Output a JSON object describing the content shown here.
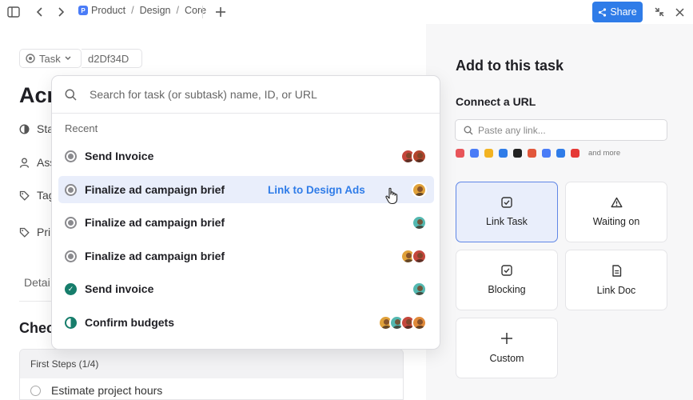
{
  "topbar": {
    "breadcrumb": [
      "Product",
      "Design",
      "Core"
    ],
    "project_badge": "P",
    "share_label": "Share"
  },
  "task": {
    "type_label": "Task",
    "id": "d2Df34D",
    "title_visible": "Acn",
    "fields": [
      {
        "label": "Sta",
        "icon": "status-icon"
      },
      {
        "label": "Ass",
        "icon": "user-icon"
      },
      {
        "label": "Tag",
        "icon": "tag-icon"
      },
      {
        "label": "Pri",
        "icon": "tag-icon"
      }
    ],
    "tabs_visible": "Detai",
    "checklists_visible": "Chec",
    "checklist": {
      "header": "First Steps (1/4)",
      "items": [
        "Estimate project hours"
      ]
    }
  },
  "dropdown": {
    "search_placeholder": "Search for task (or subtask) name, ID, or URL",
    "section_label": "Recent",
    "rows": [
      {
        "label": "Send Invoice",
        "status": "todo",
        "avatars": [
          "#c5463b",
          "#b3452d"
        ],
        "highlighted": false,
        "link_label": ""
      },
      {
        "label": "Finalize ad campaign brief",
        "status": "todo",
        "avatars": [
          "#e0a13a"
        ],
        "highlighted": true,
        "link_label": "Link to Design Ads"
      },
      {
        "label": "Finalize ad campaign brief",
        "status": "todo",
        "avatars": [
          "#53b8b0"
        ],
        "highlighted": false,
        "link_label": ""
      },
      {
        "label": "Finalize ad campaign brief",
        "status": "todo",
        "avatars": [
          "#e0a13a",
          "#c4473c"
        ],
        "highlighted": false,
        "link_label": ""
      },
      {
        "label": "Send invoice",
        "status": "done",
        "avatars": [
          "#53b8b0"
        ],
        "highlighted": false,
        "link_label": ""
      },
      {
        "label": "Confirm budgets",
        "status": "in-progress",
        "avatars": [
          "#e0a13a",
          "#53b8b0",
          "#c4473c",
          "#e08a3a"
        ],
        "highlighted": false,
        "link_label": ""
      }
    ]
  },
  "panel": {
    "title": "Add to this task",
    "connect_label": "Connect a URL",
    "url_placeholder": "Paste any link...",
    "apps": [
      {
        "name": "clickup-icon",
        "color": "#e8555a"
      },
      {
        "name": "google-docs-icon",
        "color": "#4a7cf7"
      },
      {
        "name": "google-drive-icon",
        "color": "#f2b322"
      },
      {
        "name": "dropbox-icon",
        "color": "#2f7ce8"
      },
      {
        "name": "github-icon",
        "color": "#222222"
      },
      {
        "name": "figma-icon",
        "color": "#e2573b"
      },
      {
        "name": "slack-icon",
        "color": "#4a7cf7"
      },
      {
        "name": "loom-icon",
        "color": "#2f7ce8"
      },
      {
        "name": "youtube-icon",
        "color": "#e53935"
      }
    ],
    "more_label": "and more",
    "cards": [
      {
        "label": "Link Task",
        "icon": "check-square-icon",
        "active": true
      },
      {
        "label": "Waiting on",
        "icon": "warning-icon",
        "active": false
      },
      {
        "label": "Blocking",
        "icon": "check-square-icon",
        "active": false
      },
      {
        "label": "Link Doc",
        "icon": "doc-icon",
        "active": false
      },
      {
        "label": "Custom",
        "icon": "plus-icon",
        "active": false
      }
    ]
  },
  "colors": {
    "accent": "#2f7ce8",
    "highlight_bg": "#e9eefb",
    "done_green": "#167d6b"
  }
}
